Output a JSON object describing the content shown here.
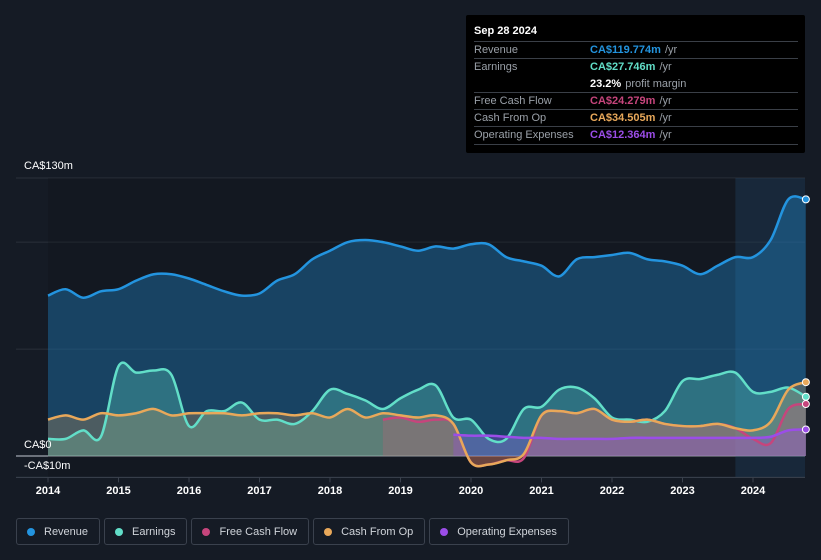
{
  "tooltip": {
    "date": "Sep 28 2024",
    "rows": [
      {
        "label": "Revenue",
        "value": "CA$119.774m",
        "unit": "/yr",
        "color": "#2394df"
      },
      {
        "label": "Earnings",
        "value": "CA$27.746m",
        "unit": "/yr",
        "color": "#62dec8"
      },
      {
        "label": "Free Cash Flow",
        "value": "CA$24.279m",
        "unit": "/yr",
        "color": "#c6457c"
      },
      {
        "label": "Cash From Op",
        "value": "CA$34.505m",
        "unit": "/yr",
        "color": "#e8a85a"
      },
      {
        "label": "Operating Expenses",
        "value": "CA$12.364m",
        "unit": "/yr",
        "color": "#9b4de8"
      }
    ],
    "profit_margin_value": "23.2%",
    "profit_margin_label": "profit margin"
  },
  "legend": [
    {
      "label": "Revenue",
      "color": "#2394df"
    },
    {
      "label": "Earnings",
      "color": "#62dec8"
    },
    {
      "label": "Free Cash Flow",
      "color": "#c6457c"
    },
    {
      "label": "Cash From Op",
      "color": "#e8a85a"
    },
    {
      "label": "Operating Expenses",
      "color": "#9b4de8"
    }
  ],
  "chart_data": {
    "type": "area",
    "title": "",
    "xlabel": "",
    "ylabel": "",
    "y_top_label": "CA$130m",
    "y_zero_label": "CA$0",
    "y_bottom_label": "-CA$10m",
    "ylim": [
      -10,
      130
    ],
    "xlim": [
      2014.0,
      2024.75
    ],
    "x_ticks": [
      "2014",
      "2015",
      "2016",
      "2017",
      "2018",
      "2019",
      "2020",
      "2021",
      "2022",
      "2023",
      "2024"
    ],
    "grid": true,
    "legend_position": "bottom-left",
    "forecast_shade_from": 2023.75,
    "series": [
      {
        "name": "Revenue",
        "color": "#2394df",
        "x": [
          2014.0,
          2014.25,
          2014.5,
          2014.75,
          2015.0,
          2015.25,
          2015.5,
          2015.75,
          2016.0,
          2016.25,
          2016.5,
          2016.75,
          2017.0,
          2017.25,
          2017.5,
          2017.75,
          2018.0,
          2018.25,
          2018.5,
          2018.75,
          2019.0,
          2019.25,
          2019.5,
          2019.75,
          2020.0,
          2020.25,
          2020.5,
          2020.75,
          2021.0,
          2021.25,
          2021.5,
          2021.75,
          2022.0,
          2022.25,
          2022.5,
          2022.75,
          2023.0,
          2023.25,
          2023.5,
          2023.75,
          2024.0,
          2024.25,
          2024.5,
          2024.75
        ],
        "values": [
          75,
          78,
          74,
          77,
          78,
          82,
          85,
          85,
          83,
          80,
          77,
          75,
          76,
          82,
          85,
          92,
          96,
          100,
          101,
          100,
          98,
          96,
          98,
          97,
          99,
          99,
          93,
          91,
          89,
          84,
          92,
          93,
          94,
          95,
          92,
          91,
          89,
          85,
          89,
          93,
          93,
          101,
          120,
          120
        ]
      },
      {
        "name": "Earnings",
        "color": "#62dec8",
        "x": [
          2014.0,
          2014.25,
          2014.5,
          2014.75,
          2015.0,
          2015.25,
          2015.5,
          2015.75,
          2016.0,
          2016.25,
          2016.5,
          2016.75,
          2017.0,
          2017.25,
          2017.5,
          2017.75,
          2018.0,
          2018.25,
          2018.5,
          2018.75,
          2019.0,
          2019.25,
          2019.5,
          2019.75,
          2020.0,
          2020.25,
          2020.5,
          2020.75,
          2021.0,
          2021.25,
          2021.5,
          2021.75,
          2022.0,
          2022.25,
          2022.5,
          2022.75,
          2023.0,
          2023.25,
          2023.5,
          2023.75,
          2024.0,
          2024.25,
          2024.5,
          2024.75
        ],
        "values": [
          8,
          8,
          12,
          9,
          42,
          39,
          40,
          38,
          14,
          21,
          21,
          25,
          17,
          17,
          15,
          21,
          31,
          29,
          26,
          22,
          27,
          31,
          33,
          18,
          17,
          8,
          8,
          22,
          23,
          31,
          32,
          27,
          18,
          17,
          16,
          21,
          35,
          36,
          38,
          39,
          30,
          30,
          32,
          27.7
        ]
      },
      {
        "name": "Free Cash Flow",
        "color": "#c6457c",
        "x": [
          2018.75,
          2019.0,
          2019.25,
          2019.5,
          2019.75,
          2020.0,
          2020.25,
          2020.5,
          2020.75,
          2021.0,
          2021.25,
          2021.5,
          2021.75,
          2022.0,
          2022.25,
          2022.5,
          2022.75,
          2023.0,
          2023.25,
          2023.5,
          2023.75,
          2024.0,
          2024.25,
          2024.5,
          2024.75
        ],
        "values": [
          17,
          18,
          16,
          17,
          15,
          -3,
          -4,
          -2,
          -1,
          19,
          21,
          20,
          22,
          17,
          16,
          17,
          15,
          14,
          14,
          15,
          13,
          8,
          6,
          22,
          24.3
        ]
      },
      {
        "name": "Cash From Op",
        "color": "#e8a85a",
        "x": [
          2014.0,
          2014.25,
          2014.5,
          2014.75,
          2015.0,
          2015.25,
          2015.5,
          2015.75,
          2016.0,
          2016.25,
          2016.5,
          2016.75,
          2017.0,
          2017.25,
          2017.5,
          2017.75,
          2018.0,
          2018.25,
          2018.5,
          2018.75,
          2019.0,
          2019.25,
          2019.5,
          2019.75,
          2020.0,
          2020.25,
          2020.5,
          2020.75,
          2021.0,
          2021.25,
          2021.5,
          2021.75,
          2022.0,
          2022.25,
          2022.5,
          2022.75,
          2023.0,
          2023.25,
          2023.5,
          2023.75,
          2024.0,
          2024.25,
          2024.5,
          2024.75
        ],
        "values": [
          17,
          19,
          17,
          20,
          19,
          20,
          22,
          19,
          20,
          20,
          20,
          19,
          20,
          20,
          19,
          20,
          18,
          22,
          18,
          20,
          19,
          18,
          19,
          15,
          -3,
          -4,
          -2,
          1,
          19,
          21,
          20,
          22,
          17,
          16,
          17,
          15,
          14,
          14,
          15,
          13,
          12,
          16,
          31,
          34.5
        ]
      },
      {
        "name": "Operating Expenses",
        "color": "#9b4de8",
        "x": [
          2019.75,
          2020.0,
          2020.25,
          2020.5,
          2020.75,
          2021.0,
          2021.25,
          2021.5,
          2021.75,
          2022.0,
          2022.25,
          2022.5,
          2022.75,
          2023.0,
          2023.25,
          2023.5,
          2023.75,
          2024.0,
          2024.25,
          2024.5,
          2024.75
        ],
        "values": [
          10,
          9.5,
          9.5,
          9,
          8.5,
          8.5,
          8,
          8,
          8,
          8,
          8.5,
          8.5,
          8.5,
          8.5,
          8.5,
          8.5,
          8.5,
          8.5,
          9,
          12,
          12.4
        ]
      }
    ]
  }
}
